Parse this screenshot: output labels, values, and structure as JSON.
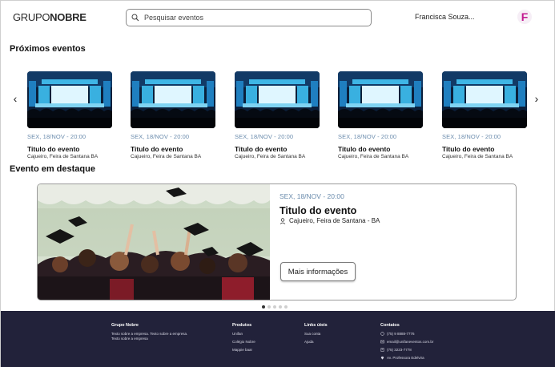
{
  "header": {
    "brand_light": "GRUPO",
    "brand_bold": "NOBRE",
    "search_placeholder": "Pesquisar eventos",
    "user_name": "Francisca Souza...",
    "avatar_letter": "F"
  },
  "upcoming": {
    "title": "Próximos eventos",
    "cards": [
      {
        "date": "SEX, 18/NOV - 20:00",
        "title": "Titulo do evento",
        "location": "Cajueiro, Feira de Santana BA"
      },
      {
        "date": "SEX, 18/NOV - 20:00",
        "title": "Titulo do evento",
        "location": "Cajueiro, Feira de Santana BA"
      },
      {
        "date": "SEX, 18/NOV - 20:00",
        "title": "Titulo do evento",
        "location": "Cajueiro, Feira de Santana BA"
      },
      {
        "date": "SEX, 18/NOV - 20:00",
        "title": "Titulo do evento",
        "location": "Cajueiro, Feira de Santana BA"
      },
      {
        "date": "SEX, 18/NOV - 20:00",
        "title": "Titulo do evento",
        "location": "Cajueiro, Feira de Santana BA"
      }
    ],
    "prev_arrow": "‹",
    "next_arrow": "›"
  },
  "featured": {
    "title": "Evento em destaque",
    "date": "SEX, 18/NOV - 20:00",
    "event_title": "Titulo do evento",
    "location": "Cajueiro, Feira de Santana - BA",
    "button_label": "Mais informações",
    "pagination": {
      "total": 5,
      "active": 1
    }
  },
  "footer": {
    "brand": {
      "title": "Grupo Nobre",
      "description": "Texto sobre a empresa. Texto sobre a empresa. Texto sobre a empresa"
    },
    "products": {
      "title": "Produtos",
      "items": [
        "Unifan",
        "Colégio Nobre",
        "Mappie baar"
      ]
    },
    "links": {
      "title": "Links úteis",
      "items": [
        "Sua conta",
        "Ajuda"
      ]
    },
    "contacts": {
      "title": "Contatos",
      "items": [
        {
          "icon": "whatsapp-icon",
          "text": "(75) 9 8888-7776"
        },
        {
          "icon": "mail-icon",
          "text": "email@unifaneventos.com.br"
        },
        {
          "icon": "phone-icon",
          "text": "(75) 3223-7778"
        },
        {
          "icon": "location-icon",
          "text": "Av. Professora Edelvira"
        }
      ]
    }
  },
  "colors": {
    "accent_date": "#6b8cad",
    "footer_bg": "#22223a",
    "avatar": "#c2188f"
  }
}
